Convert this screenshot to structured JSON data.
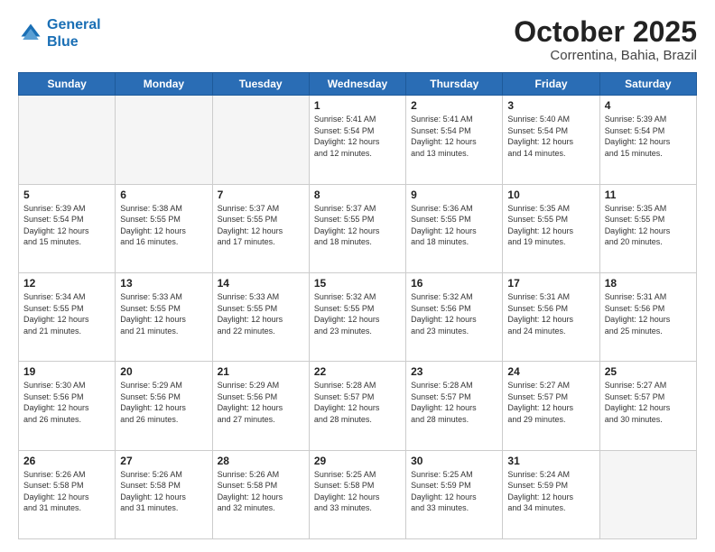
{
  "header": {
    "logo_line1": "General",
    "logo_line2": "Blue",
    "month": "October 2025",
    "location": "Correntina, Bahia, Brazil"
  },
  "weekdays": [
    "Sunday",
    "Monday",
    "Tuesday",
    "Wednesday",
    "Thursday",
    "Friday",
    "Saturday"
  ],
  "weeks": [
    [
      {
        "day": "",
        "info": "",
        "empty": true
      },
      {
        "day": "",
        "info": "",
        "empty": true
      },
      {
        "day": "",
        "info": "",
        "empty": true
      },
      {
        "day": "1",
        "info": "Sunrise: 5:41 AM\nSunset: 5:54 PM\nDaylight: 12 hours\nand 12 minutes."
      },
      {
        "day": "2",
        "info": "Sunrise: 5:41 AM\nSunset: 5:54 PM\nDaylight: 12 hours\nand 13 minutes."
      },
      {
        "day": "3",
        "info": "Sunrise: 5:40 AM\nSunset: 5:54 PM\nDaylight: 12 hours\nand 14 minutes."
      },
      {
        "day": "4",
        "info": "Sunrise: 5:39 AM\nSunset: 5:54 PM\nDaylight: 12 hours\nand 15 minutes."
      }
    ],
    [
      {
        "day": "5",
        "info": "Sunrise: 5:39 AM\nSunset: 5:54 PM\nDaylight: 12 hours\nand 15 minutes."
      },
      {
        "day": "6",
        "info": "Sunrise: 5:38 AM\nSunset: 5:55 PM\nDaylight: 12 hours\nand 16 minutes."
      },
      {
        "day": "7",
        "info": "Sunrise: 5:37 AM\nSunset: 5:55 PM\nDaylight: 12 hours\nand 17 minutes."
      },
      {
        "day": "8",
        "info": "Sunrise: 5:37 AM\nSunset: 5:55 PM\nDaylight: 12 hours\nand 18 minutes."
      },
      {
        "day": "9",
        "info": "Sunrise: 5:36 AM\nSunset: 5:55 PM\nDaylight: 12 hours\nand 18 minutes."
      },
      {
        "day": "10",
        "info": "Sunrise: 5:35 AM\nSunset: 5:55 PM\nDaylight: 12 hours\nand 19 minutes."
      },
      {
        "day": "11",
        "info": "Sunrise: 5:35 AM\nSunset: 5:55 PM\nDaylight: 12 hours\nand 20 minutes."
      }
    ],
    [
      {
        "day": "12",
        "info": "Sunrise: 5:34 AM\nSunset: 5:55 PM\nDaylight: 12 hours\nand 21 minutes."
      },
      {
        "day": "13",
        "info": "Sunrise: 5:33 AM\nSunset: 5:55 PM\nDaylight: 12 hours\nand 21 minutes."
      },
      {
        "day": "14",
        "info": "Sunrise: 5:33 AM\nSunset: 5:55 PM\nDaylight: 12 hours\nand 22 minutes."
      },
      {
        "day": "15",
        "info": "Sunrise: 5:32 AM\nSunset: 5:55 PM\nDaylight: 12 hours\nand 23 minutes."
      },
      {
        "day": "16",
        "info": "Sunrise: 5:32 AM\nSunset: 5:56 PM\nDaylight: 12 hours\nand 23 minutes."
      },
      {
        "day": "17",
        "info": "Sunrise: 5:31 AM\nSunset: 5:56 PM\nDaylight: 12 hours\nand 24 minutes."
      },
      {
        "day": "18",
        "info": "Sunrise: 5:31 AM\nSunset: 5:56 PM\nDaylight: 12 hours\nand 25 minutes."
      }
    ],
    [
      {
        "day": "19",
        "info": "Sunrise: 5:30 AM\nSunset: 5:56 PM\nDaylight: 12 hours\nand 26 minutes."
      },
      {
        "day": "20",
        "info": "Sunrise: 5:29 AM\nSunset: 5:56 PM\nDaylight: 12 hours\nand 26 minutes."
      },
      {
        "day": "21",
        "info": "Sunrise: 5:29 AM\nSunset: 5:56 PM\nDaylight: 12 hours\nand 27 minutes."
      },
      {
        "day": "22",
        "info": "Sunrise: 5:28 AM\nSunset: 5:57 PM\nDaylight: 12 hours\nand 28 minutes."
      },
      {
        "day": "23",
        "info": "Sunrise: 5:28 AM\nSunset: 5:57 PM\nDaylight: 12 hours\nand 28 minutes."
      },
      {
        "day": "24",
        "info": "Sunrise: 5:27 AM\nSunset: 5:57 PM\nDaylight: 12 hours\nand 29 minutes."
      },
      {
        "day": "25",
        "info": "Sunrise: 5:27 AM\nSunset: 5:57 PM\nDaylight: 12 hours\nand 30 minutes."
      }
    ],
    [
      {
        "day": "26",
        "info": "Sunrise: 5:26 AM\nSunset: 5:58 PM\nDaylight: 12 hours\nand 31 minutes."
      },
      {
        "day": "27",
        "info": "Sunrise: 5:26 AM\nSunset: 5:58 PM\nDaylight: 12 hours\nand 31 minutes."
      },
      {
        "day": "28",
        "info": "Sunrise: 5:26 AM\nSunset: 5:58 PM\nDaylight: 12 hours\nand 32 minutes."
      },
      {
        "day": "29",
        "info": "Sunrise: 5:25 AM\nSunset: 5:58 PM\nDaylight: 12 hours\nand 33 minutes."
      },
      {
        "day": "30",
        "info": "Sunrise: 5:25 AM\nSunset: 5:59 PM\nDaylight: 12 hours\nand 33 minutes."
      },
      {
        "day": "31",
        "info": "Sunrise: 5:24 AM\nSunset: 5:59 PM\nDaylight: 12 hours\nand 34 minutes."
      },
      {
        "day": "",
        "info": "",
        "empty": true
      }
    ]
  ]
}
